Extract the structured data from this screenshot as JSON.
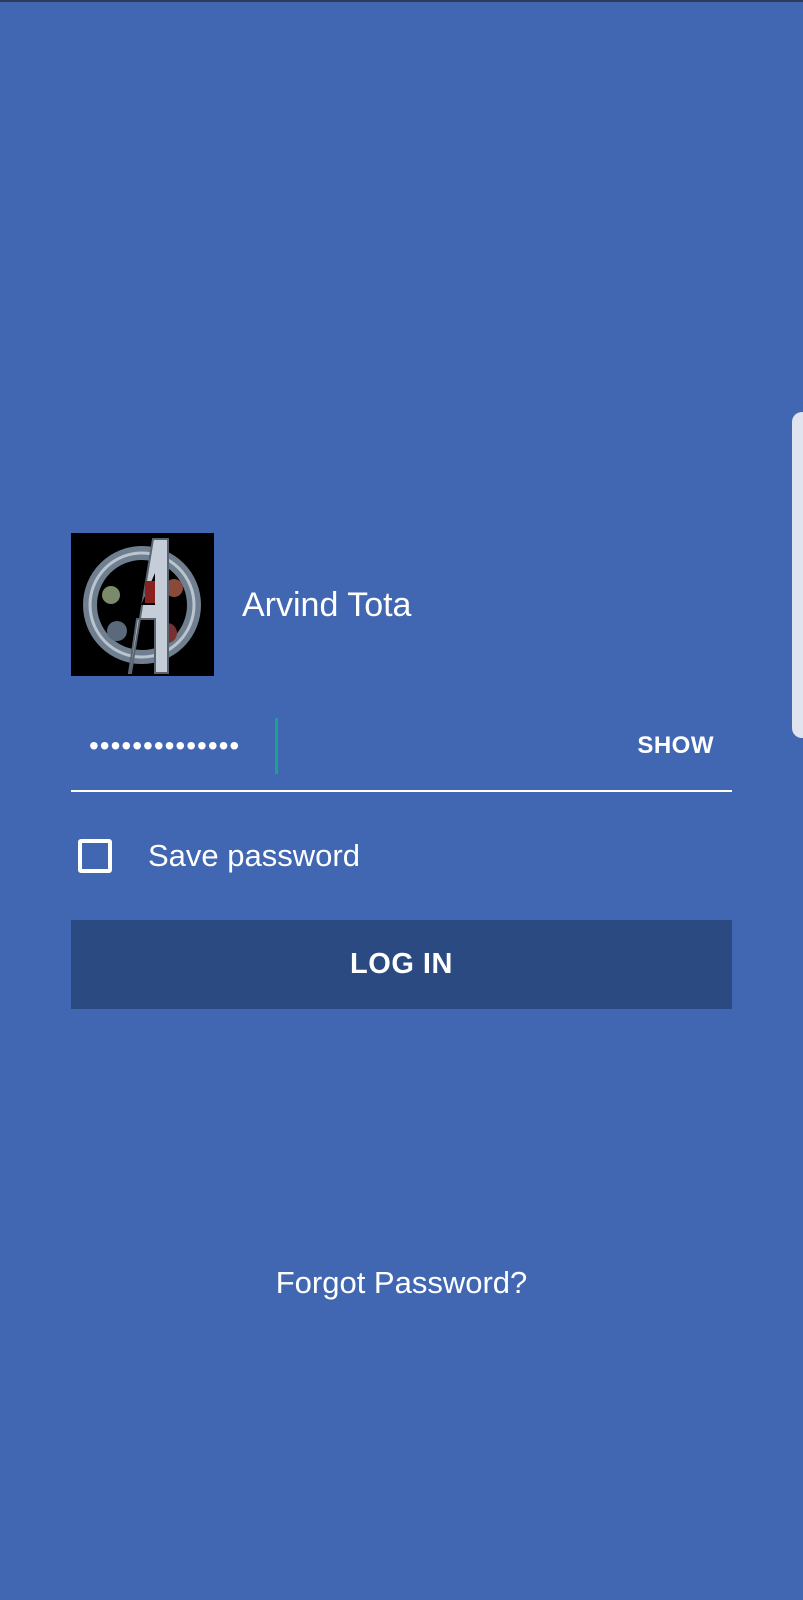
{
  "profile": {
    "username": "Arvind Tota",
    "avatar_icon": "avengers-logo-avatar"
  },
  "password": {
    "masked_value": "••••••••••••••",
    "show_label": "SHOW"
  },
  "save_password": {
    "label": "Save password",
    "checked": false
  },
  "login": {
    "label": "LOG IN"
  },
  "forgot": {
    "label": "Forgot Password?"
  },
  "colors": {
    "background": "#4267b2",
    "button": "#2b4a82",
    "caret": "#1aa18f",
    "text": "#ffffff"
  }
}
